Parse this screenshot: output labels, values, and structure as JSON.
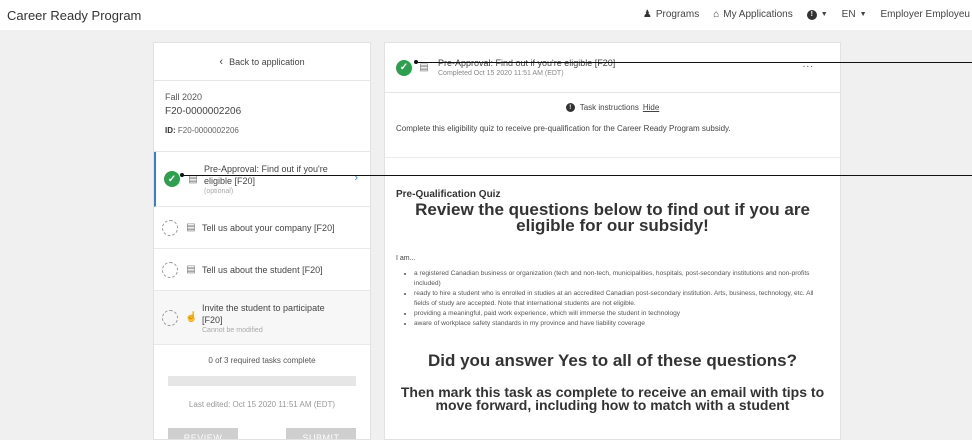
{
  "app": {
    "title": "Career Ready Program"
  },
  "topnav": {
    "programs": "Programs",
    "my_applications": "My Applications",
    "language": "EN",
    "user": "Employer Employeu",
    "programs_icon": "people-icon",
    "applications_icon": "home-icon",
    "help_icon": "info-circle-icon"
  },
  "left": {
    "back_label": "Back to application",
    "term": "Fall 2020",
    "app_number": "F20-0000002206",
    "id_label": "ID:",
    "id_value": "F20-0000002206",
    "tasks": [
      {
        "name": "Pre-Approval: Find out if you're eligible [F20]",
        "sub": "(optional)",
        "status": "complete",
        "icon": "document-icon"
      },
      {
        "name": "Tell us about your company [F20]",
        "sub": "",
        "status": "incomplete",
        "icon": "document-icon"
      },
      {
        "name": "Tell us about the student [F20]",
        "sub": "",
        "status": "incomplete",
        "icon": "document-icon"
      },
      {
        "name": "Invite the student to participate [F20]",
        "sub": "Cannot be modified",
        "status": "incomplete",
        "icon": "thumbs-up-icon"
      }
    ],
    "progress_text": "0 of 3 required tasks complete",
    "progress_fraction": 0,
    "last_edited": "Last edited: Oct 15 2020 11:51 AM (EDT)",
    "review_label": "REVIEW",
    "submit_label": "SUBMIT"
  },
  "right": {
    "task_title": "Pre-Approval: Find out if you're eligible [F20]",
    "task_completed": "Completed Oct 15 2020 11:51 AM (EDT)",
    "more_label": "...",
    "instructions_label": "Task instructions",
    "hide_label": "Hide",
    "instructions_text": "Complete this eligibility quiz to receive pre-qualification for the Career Ready Program subsidy.",
    "quiz_title": "Pre-Qualification Quiz",
    "quiz_heading": "Review the questions below to find out if you are eligible for our subsidy!",
    "iam": "I am...",
    "bullets": [
      "a registered Canadian business or organization (tech and non-tech, municipalities, hospitals, post-secondary institutions and non-profits included)",
      "ready to hire a student who is enrolled in studies at an accredited Canadian post-secondary institution. Arts, business, technology, etc. All fields of study are accepted. Note that international students are not eligible.",
      "providing a meaningful, paid work experience, which will immerse the student in technology",
      "aware of workplace safety standards in my province and have liability coverage"
    ],
    "question_heading": "Did you answer Yes to all of these questions?",
    "followup": "Then mark this task as complete to receive an email with tips to move forward, including how to match with a student"
  },
  "colors": {
    "accent": "#3a7bd5",
    "success": "#2e9e4f",
    "background": "#f0f0f0"
  }
}
